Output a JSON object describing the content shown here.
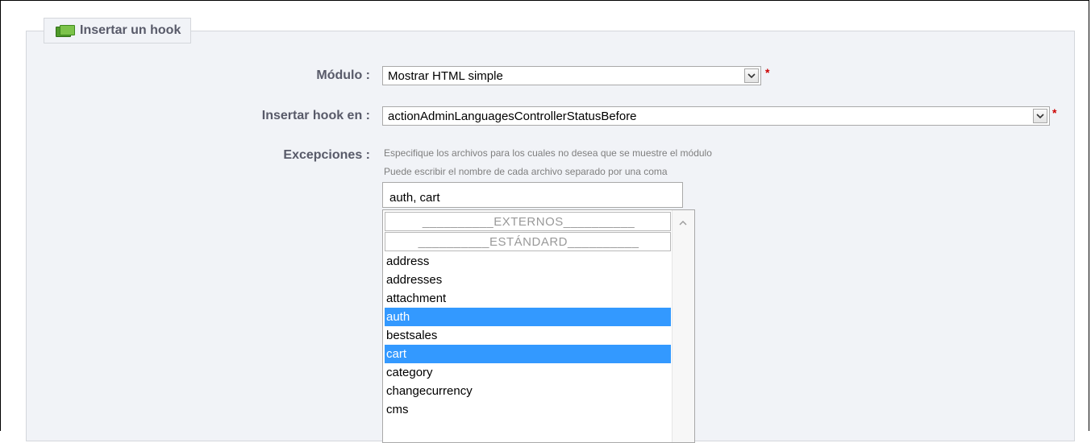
{
  "fieldset": {
    "legend": "Insertar un hook",
    "legend_icon": "modules-icon"
  },
  "form": {
    "module_label": "Módulo :",
    "module_value": "Mostrar HTML simple",
    "hook_label": "Insertar hook en :",
    "hook_value": "actionAdminLanguagesControllerStatusBefore",
    "required_mark": "*",
    "exceptions_label": "Excepciones :",
    "exceptions_hint1": "Especifique los archivos para los cuales no desea que se muestre el módulo",
    "exceptions_hint2": "Puede escribir el nombre de cada archivo separado por una coma",
    "exceptions_value": "auth, cart"
  },
  "listbox": {
    "groups": [
      "__________EXTERNOS__________",
      "__________ESTÁNDARD__________"
    ],
    "items": [
      {
        "label": "address",
        "selected": false
      },
      {
        "label": "addresses",
        "selected": false
      },
      {
        "label": "attachment",
        "selected": false
      },
      {
        "label": "auth",
        "selected": true
      },
      {
        "label": "bestsales",
        "selected": false
      },
      {
        "label": "cart",
        "selected": true
      },
      {
        "label": "category",
        "selected": false
      },
      {
        "label": "changecurrency",
        "selected": false
      },
      {
        "label": "cms",
        "selected": false
      }
    ]
  },
  "colors": {
    "selected_bg": "#3399ff",
    "label_text": "#585a69",
    "required": "#cc0000",
    "panel_bg": "#f1f3f7"
  }
}
